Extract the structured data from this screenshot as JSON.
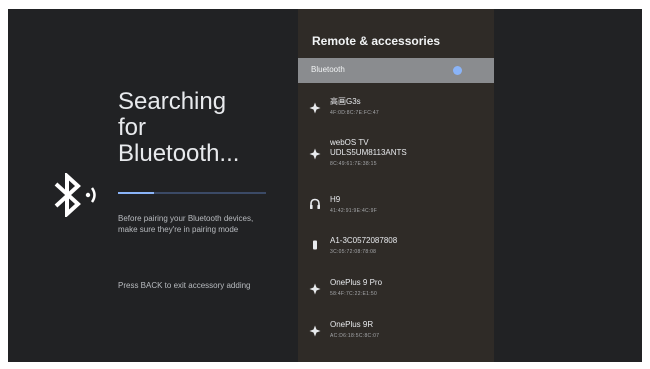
{
  "search_page": {
    "title_lines": [
      "Searching",
      "for",
      "Bluetooth..."
    ],
    "hint_pairing": "Before pairing your Bluetooth devices, make sure they're in pairing mode",
    "hint_back": "Press BACK to exit accessory adding"
  },
  "panel": {
    "title": "Remote & accessories",
    "selected_item": "Bluetooth",
    "devices": [
      {
        "name": "高画G3s",
        "address": "4F:0D:8C:7E:FC:47",
        "icon": "bluetooth-icon"
      },
      {
        "name": "webOS TV\nUDLS5UM8113ANTS",
        "address": "8C:49:61:7E:38:15",
        "icon": "bluetooth-icon"
      },
      {
        "name": "H9",
        "address": "41:42:91:9E:4C:9F",
        "icon": "headphones-icon"
      },
      {
        "name": "A1-3C0572087808",
        "address": "3C:05:72:08:78:08",
        "icon": "phone-icon"
      },
      {
        "name": "OnePlus 9 Pro",
        "address": "58:4F:7C:22:E1:50",
        "icon": "bluetooth-icon"
      },
      {
        "name": "OnePlus 9R",
        "address": "AC:D6:18:5C:8C:07",
        "icon": "bluetooth-icon"
      }
    ]
  },
  "colors": {
    "accent": "#8ab4f8",
    "background": "#212224",
    "panel": "#2f2b27",
    "highlight": "#8a8c8f"
  }
}
